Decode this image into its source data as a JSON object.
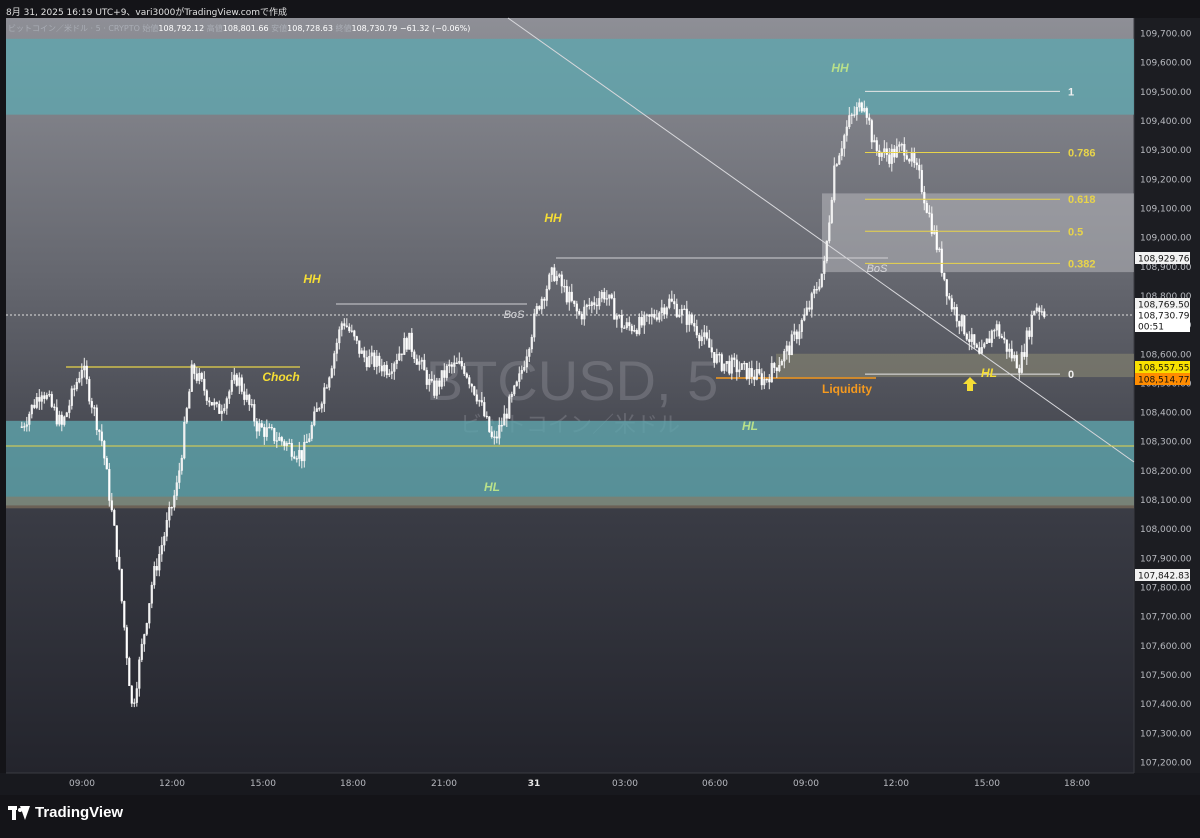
{
  "header": {
    "date_line": "8月 31, 2025 16:19 UTC+9、vari3000がTradingView.comで作成"
  },
  "legend": {
    "symbol_desc": "ビットコイン／米ドル · 5 · CRYPTO",
    "open_label": "始値",
    "open": "108,792.12",
    "high_label": "高値",
    "high": "108,801.66",
    "low_label": "安値",
    "low": "108,728.63",
    "close_label": "終値",
    "close": "108,730.79",
    "change": "−61.32 (−0.06%)"
  },
  "watermark": {
    "symbol": "BTCUSD, 5",
    "name": "ビットコイン／米ドル"
  },
  "brand": {
    "name": "TradingView"
  },
  "colors": {
    "zone_teal": "#5fa6ae",
    "zone_grey": "#c8c8cc",
    "zone_olive": "#8c8a72",
    "fib_yellow": "#e8d44a",
    "label_green": "#b8e08a",
    "label_yellow": "#f5dd35",
    "liquidity_orange": "#f59a1f",
    "candle": "#f0f0f0",
    "price_tag_yellow": "#f8e100",
    "price_tag_orange": "#ff8c00"
  },
  "chart_data": {
    "type": "candlestick",
    "title": "BTCUSD, 5",
    "xlabel": "",
    "ylabel": "",
    "ylim": [
      107100,
      109800
    ],
    "x_ticks": [
      "09:00",
      "12:00",
      "15:00",
      "18:00",
      "21:00",
      "31",
      "03:00",
      "06:00",
      "09:00",
      "12:00",
      "15:00",
      "18:00"
    ],
    "y_ticks": [
      "109,700.00",
      "109,600.00",
      "109,500.00",
      "109,400.00",
      "109,300.00",
      "109,200.00",
      "109,100.00",
      "109,000.00",
      "108,900.00",
      "108,800.00",
      "108,700.00",
      "108,600.00",
      "108,500.00",
      "108,400.00",
      "108,300.00",
      "108,200.00",
      "108,100.00",
      "108,000.00",
      "107,900.00",
      "107,800.00",
      "107,700.00",
      "107,600.00",
      "107,500.00",
      "107,400.00",
      "107,300.00",
      "107,200.00"
    ],
    "price_path": [
      [
        "07:00",
        108350
      ],
      [
        "07:40",
        108480
      ],
      [
        "08:20",
        108350
      ],
      [
        "09:00",
        108560
      ],
      [
        "09:40",
        108300
      ],
      [
        "10:10",
        107920
      ],
      [
        "10:40",
        107380
      ],
      [
        "11:20",
        107820
      ],
      [
        "12:10",
        108150
      ],
      [
        "12:40",
        108550
      ],
      [
        "13:30",
        108400
      ],
      [
        "14:10",
        108520
      ],
      [
        "14:50",
        108350
      ],
      [
        "15:40",
        108300
      ],
      [
        "16:20",
        108250
      ],
      [
        "17:10",
        108520
      ],
      [
        "17:40",
        108720
      ],
      [
        "18:20",
        108590
      ],
      [
        "19:10",
        108550
      ],
      [
        "19:50",
        108650
      ],
      [
        "20:40",
        108470
      ],
      [
        "21:10",
        108550
      ],
      [
        "21:40",
        108560
      ],
      [
        "22:10",
        108450
      ],
      [
        "22:40",
        108290
      ],
      [
        "23:30",
        108500
      ],
      [
        "00:10",
        108770
      ],
      [
        "00:40",
        108880
      ],
      [
        "01:30",
        108730
      ],
      [
        "02:20",
        108810
      ],
      [
        "03:00",
        108690
      ],
      [
        "03:40",
        108700
      ],
      [
        "04:30",
        108780
      ],
      [
        "05:20",
        108700
      ],
      [
        "06:10",
        108570
      ],
      [
        "06:50",
        108550
      ],
      [
        "07:40",
        108510
      ],
      [
        "08:30",
        108620
      ],
      [
        "09:10",
        108760
      ],
      [
        "09:40",
        108900
      ],
      [
        "10:00",
        109250
      ],
      [
        "10:30",
        109400
      ],
      [
        "11:00",
        109470
      ],
      [
        "11:20",
        109300
      ],
      [
        "11:50",
        109280
      ],
      [
        "12:20",
        109310
      ],
      [
        "12:50",
        109200
      ],
      [
        "13:20",
        109000
      ],
      [
        "13:50",
        108780
      ],
      [
        "14:30",
        108650
      ],
      [
        "14:50",
        108580
      ],
      [
        "15:20",
        108700
      ],
      [
        "15:50",
        108600
      ],
      [
        "16:10",
        108560
      ],
      [
        "16:40",
        108770
      ],
      [
        "17:00",
        108740
      ]
    ],
    "current_price": 108730.79,
    "price_labels": [
      {
        "text": "108,929.76",
        "value": 108929.76,
        "style": "light"
      },
      {
        "text": "108,769.50",
        "value": 108769.5,
        "style": "light"
      },
      {
        "text": "108,730.79",
        "value": 108730.79,
        "style": "current"
      },
      {
        "text": "00:51",
        "value": 108690,
        "style": "countdown"
      },
      {
        "text": "108,557.55",
        "value": 108557.55,
        "style": "yellow"
      },
      {
        "text": "108,514.77",
        "value": 108514.77,
        "style": "orange"
      },
      {
        "text": "107,842.83",
        "value": 107842.83,
        "style": "light"
      }
    ],
    "zones": [
      {
        "name": "upper-supply-zone",
        "from": 109420,
        "to": 109680,
        "color": "teal"
      },
      {
        "name": "fib-grey-zone",
        "from": 108880,
        "to": 109150,
        "color": "grey"
      },
      {
        "name": "demand-olive-zone",
        "from": 108520,
        "to": 108600,
        "color": "olive"
      },
      {
        "name": "lower-demand-zone",
        "from": 108080,
        "to": 108370,
        "color": "teal"
      }
    ],
    "fibonacci": [
      {
        "label": "1",
        "value": 109500
      },
      {
        "label": "0.786",
        "value": 109290
      },
      {
        "label": "0.618",
        "value": 109130
      },
      {
        "label": "0.5",
        "value": 109020
      },
      {
        "label": "0.382",
        "value": 108910
      },
      {
        "label": "0",
        "value": 108530
      }
    ],
    "structure_labels": [
      {
        "text": "HH",
        "style": "green"
      },
      {
        "text": "HH",
        "style": "yellow"
      },
      {
        "text": "HH",
        "style": "yellow"
      },
      {
        "text": "Choch",
        "style": "yellow"
      },
      {
        "text": "BoS",
        "style": "white"
      },
      {
        "text": "BoS",
        "style": "white"
      },
      {
        "text": "HL",
        "style": "green"
      },
      {
        "text": "HL",
        "style": "green"
      },
      {
        "text": "HL",
        "style": "yellow"
      },
      {
        "text": "Liquidity",
        "style": "orange"
      }
    ]
  }
}
